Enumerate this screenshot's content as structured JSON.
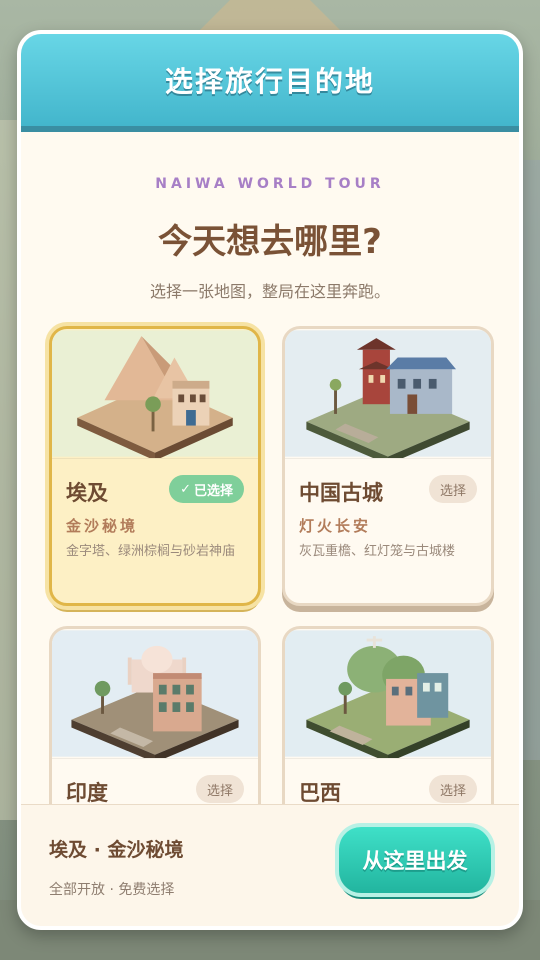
{
  "header": {
    "title": "选择旅行目的地"
  },
  "intro": {
    "subtitle_en": "NAIWA WORLD TOUR",
    "headline": "今天想去哪里?",
    "description": "选择一张地图，整局在这里奔跑。"
  },
  "destinations": [
    {
      "name": "埃及",
      "tagline": "金沙秘境",
      "info": "金字塔、绿洲棕榈与砂岩神庙",
      "status": "已选择",
      "selected": true,
      "scene": "egypt-scene"
    },
    {
      "name": "中国古城",
      "tagline": "灯火长安",
      "info": "灰瓦重檐、红灯笼与古城楼",
      "status": "选择",
      "selected": false,
      "scene": "china-scene"
    },
    {
      "name": "印度",
      "tagline": "",
      "info": "",
      "status": "选择",
      "selected": false,
      "scene": "india-scene"
    },
    {
      "name": "巴西",
      "tagline": "",
      "info": "",
      "status": "选择",
      "selected": false,
      "scene": "brazil-scene"
    }
  ],
  "footer": {
    "selection": "埃及 · 金沙秘境",
    "note": "全部开放 · 免费选择",
    "go_label": "从这里出发"
  },
  "icons": {
    "check": "check-icon"
  },
  "colors": {
    "header": "#4bc0d6",
    "go_button": "#2bc7af",
    "selected_border": "#e0b648"
  }
}
